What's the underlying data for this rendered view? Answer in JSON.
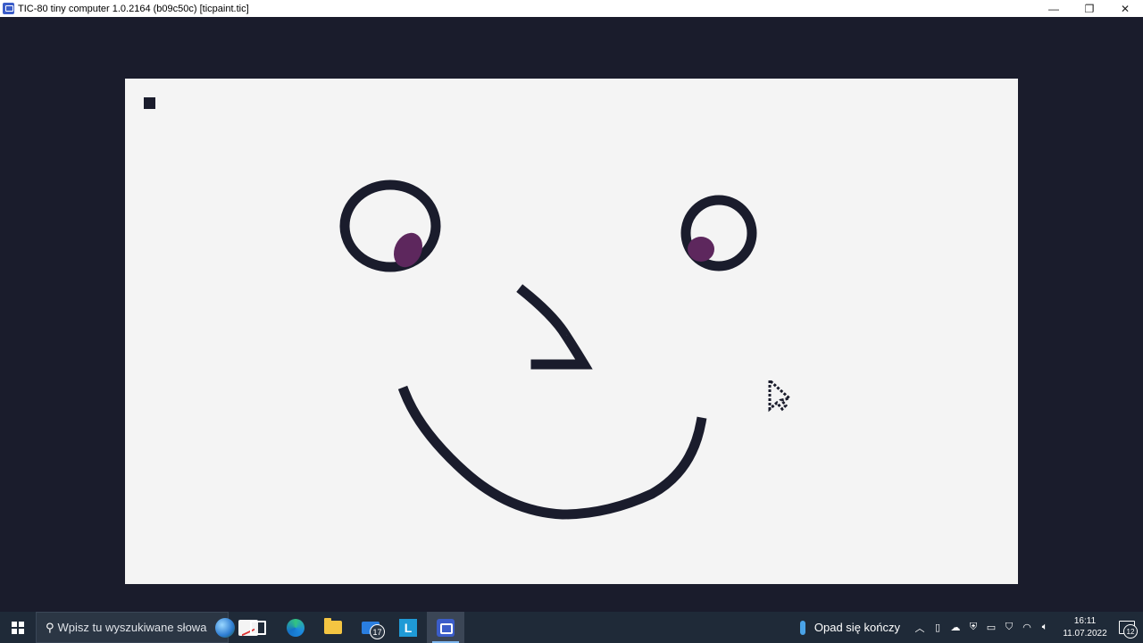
{
  "window": {
    "title": "TIC-80 tiny computer 1.0.2164 (b09c50c) [ticpaint.tic]",
    "controls": {
      "minimize": "—",
      "restore": "❐",
      "close": "✕"
    }
  },
  "game": {
    "background_color": "#1a1c2c",
    "canvas_color": "#f4f4f4",
    "ink_color": "#1a1c2c",
    "pupil_color": "#5d275d",
    "drawing_elements": [
      "selected-color-swatch",
      "left-eye",
      "right-eye",
      "nose",
      "mouth",
      "mouse-cursor"
    ]
  },
  "taskbar": {
    "search_placeholder": "Wpisz tu wyszukiwane słowa",
    "apps": [
      {
        "name": "task-view",
        "icon": "task-view-icon"
      },
      {
        "name": "edge",
        "icon": "edge-icon"
      },
      {
        "name": "file-explorer",
        "icon": "folder-icon"
      },
      {
        "name": "mail",
        "icon": "mail-icon",
        "badge": "17"
      },
      {
        "name": "l-app",
        "icon": "l-app-icon",
        "label": "L"
      },
      {
        "name": "tic-80",
        "icon": "tic80-icon",
        "active": true
      }
    ],
    "weather": "Opad się kończy",
    "tray_icons": [
      "chevron-up-icon",
      "meet-now-icon",
      "onedrive-icon",
      "security-icon",
      "battery-icon",
      "defender-icon",
      "wifi-icon",
      "volume-icon"
    ],
    "time": "16:11",
    "date": "11.07.2022",
    "notifications_count": "12"
  }
}
